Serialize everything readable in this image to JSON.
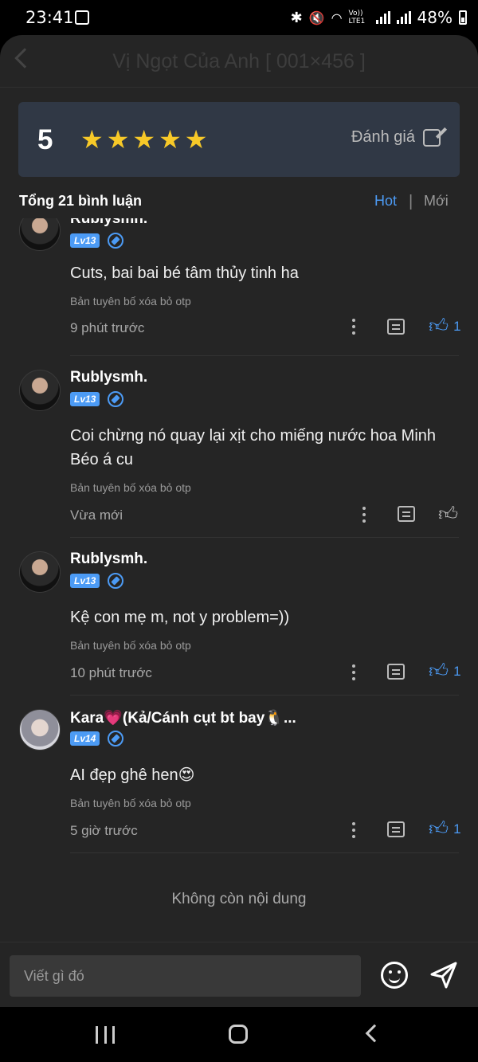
{
  "status_bar": {
    "time": "23:41",
    "battery": "48%",
    "network_label": "Vo)) LTE1",
    "icons": [
      "gallery-icon",
      "bluetooth-icon",
      "mute-icon",
      "wifi-icon",
      "signal-icon",
      "battery-icon"
    ]
  },
  "header": {
    "title": "Vị Ngọt Của Anh [ 001×456 ]"
  },
  "rating": {
    "score": "5",
    "stars": 5,
    "rate_label": "Đánh giá"
  },
  "comments_header": {
    "total": "Tổng 21 bình luận",
    "sort_hot": "Hot",
    "sort_sep": "|",
    "sort_new": "Mới"
  },
  "comments": [
    {
      "user": "Rublysmh.",
      "level": "Lv13",
      "text": "Cuts, bai bai bé tâm thủy tinh ha",
      "note": "Bản tuyên bố xóa bỏ otp",
      "time": "9 phút trước",
      "likes": "1",
      "liked": true
    },
    {
      "user": "Rublysmh.",
      "level": "Lv13",
      "text": "Coi chừng nó quay lại xịt cho miếng nước hoa Minh Béo á cu",
      "note": "Bản tuyên bố xóa bỏ otp",
      "time": "Vừa mới",
      "likes": "",
      "liked": false
    },
    {
      "user": "Rublysmh.",
      "level": "Lv13",
      "text": "Kệ con mẹ m, not y problem=))",
      "note": "Bản tuyên bố xóa bỏ otp",
      "time": "10 phút trước",
      "likes": "1",
      "liked": true
    },
    {
      "user": "Kara💗(Kả/Cánh cụt bt bay🐧...",
      "level": "Lv14",
      "text": "AI đẹp ghê hen😍",
      "note": "Bản tuyên bố xóa bỏ otp",
      "time": "5 giờ trước",
      "likes": "1",
      "liked": true
    }
  ],
  "end_note": "Không còn nội dung",
  "composer": {
    "placeholder": "Viết gì đó"
  },
  "colors": {
    "accent": "#4c9bf5",
    "star": "#f7c928",
    "sheet": "#252525",
    "card": "#303845"
  }
}
